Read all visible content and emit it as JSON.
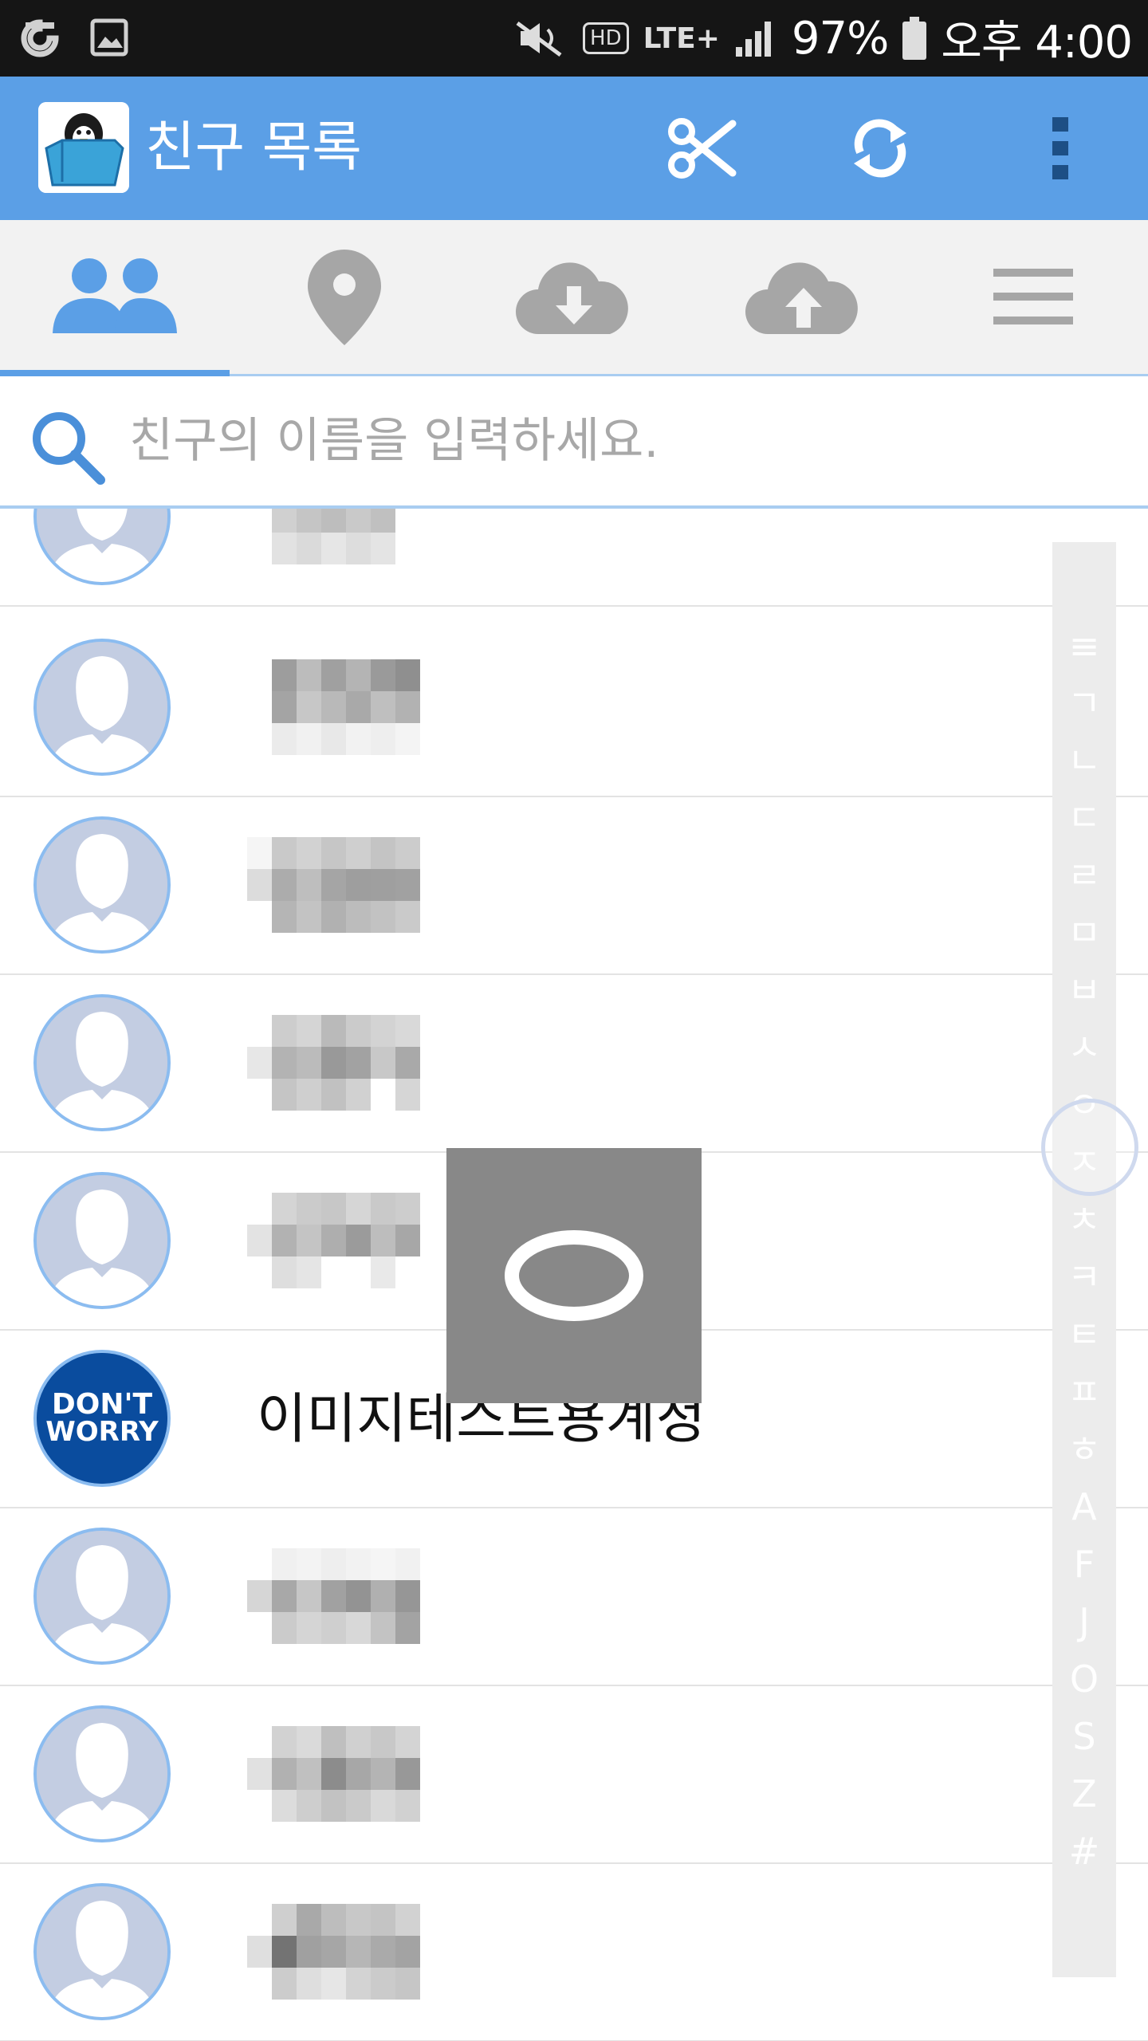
{
  "status_bar": {
    "battery_percent": "97%",
    "network": "LTE+",
    "hd_label": "HD",
    "time": "오후 4:00"
  },
  "app_bar": {
    "title": "친구 목록"
  },
  "tabs": [
    {
      "icon": "friends-icon",
      "active": true
    },
    {
      "icon": "location-pin-icon",
      "active": false
    },
    {
      "icon": "cloud-download-icon",
      "active": false
    },
    {
      "icon": "cloud-upload-icon",
      "active": false
    },
    {
      "icon": "menu-icon",
      "active": false
    }
  ],
  "search": {
    "placeholder": "친구의 이름을 입력하세요.",
    "value": ""
  },
  "friends": [
    {
      "name": "",
      "avatar": "default"
    },
    {
      "name": "",
      "avatar": "default"
    },
    {
      "name": "",
      "avatar": "default"
    },
    {
      "name": "",
      "avatar": "default"
    },
    {
      "name": "",
      "avatar": "default"
    },
    {
      "name": "이미지테스트용계정",
      "avatar": "dont-worry"
    },
    {
      "name": "",
      "avatar": "default"
    },
    {
      "name": "",
      "avatar": "default"
    },
    {
      "name": "",
      "avatar": "default"
    }
  ],
  "dont_worry_logo": {
    "line1": "DON'T",
    "line2": "WORRY"
  },
  "index_letters": [
    "≡",
    "ㄱ",
    "ㄴ",
    "ㄷ",
    "ㄹ",
    "ㅁ",
    "ㅂ",
    "ㅅ",
    "ㅇ",
    "ㅈ",
    "ㅊ",
    "ㅋ",
    "ㅌ",
    "ㅍ",
    "ㅎ",
    "A",
    "F",
    "J",
    "O",
    "S",
    "Z",
    "#"
  ],
  "overlay_letter": "ㅇ",
  "colors": {
    "primary": "#5b9fe6",
    "status_bar": "#151515",
    "tab_bg": "#f2f2f2",
    "tab_icon": "#a6a6a6",
    "overlay": "#888888"
  }
}
